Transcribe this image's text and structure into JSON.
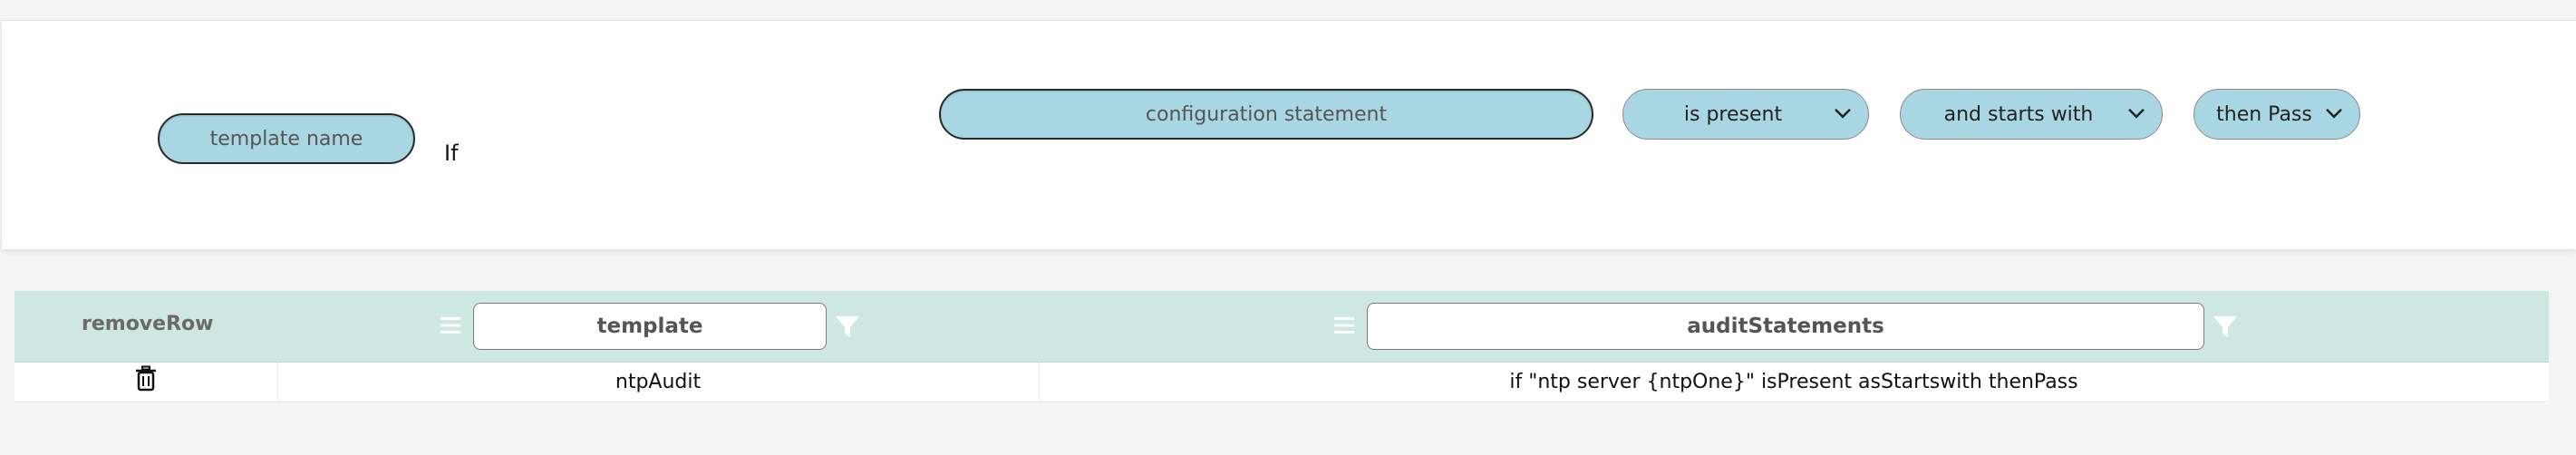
{
  "builder": {
    "template_name_placeholder": "template name",
    "if_label": "If",
    "config_statement_placeholder": "configuration statement",
    "presence_select": "is present",
    "match_select": "and starts with",
    "result_select": "then Pass"
  },
  "grid": {
    "columns": [
      "removeRow",
      "template",
      "auditStatements"
    ],
    "rows": [
      {
        "template": "ntpAudit",
        "auditStatements": "if \"ntp server {ntpOne}\" isPresent asStartswith thenPass"
      }
    ]
  },
  "colors": {
    "pill": "#a8d7e3",
    "grid_header": "#cfe7e1"
  }
}
